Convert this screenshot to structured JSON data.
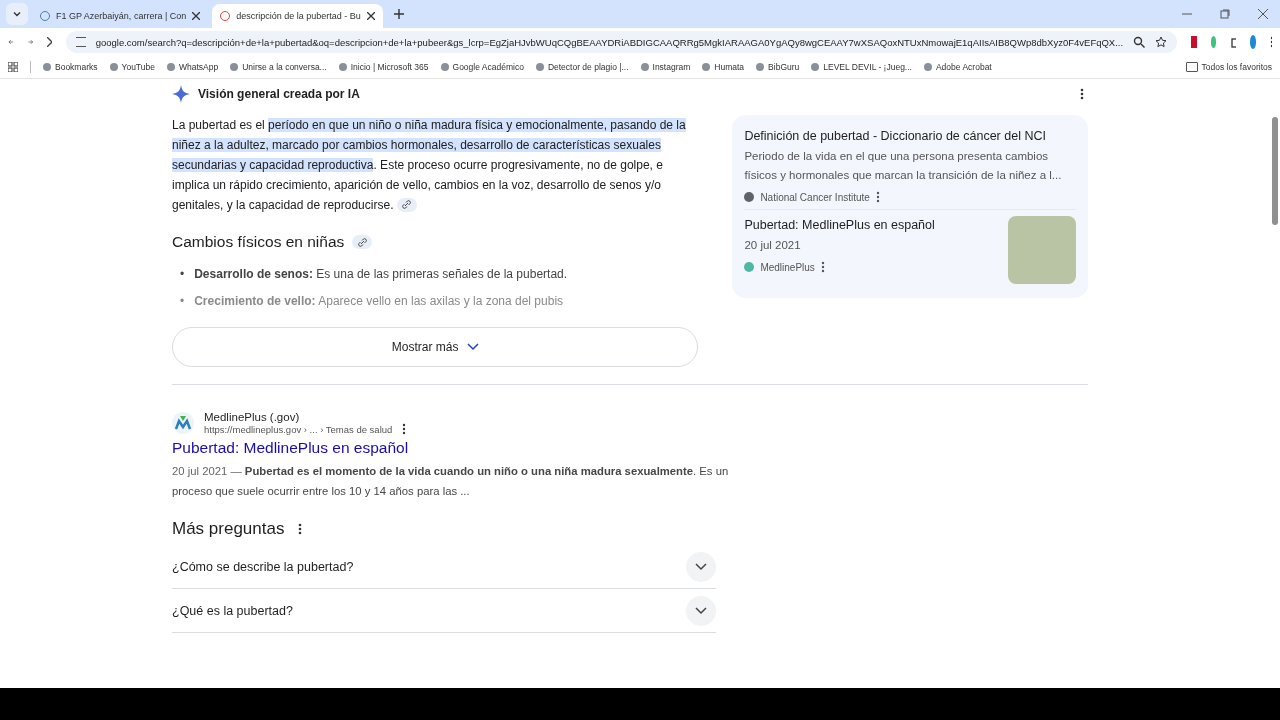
{
  "tabs": [
    {
      "title": "F1 GP Azerbaiyán, carrera | Con",
      "selected": false
    },
    {
      "title": "descripción de la pubertad - Bu",
      "selected": true
    }
  ],
  "address": "google.com/search?q=descripción+de+la+pubertad&oq=descripcion+de+la+pubeer&gs_lcrp=EgZjaHJvbWUqCQgBEAAYDRiABDIGCAAQRRg5MgkIARAAGA0YgAQy8wgCEAAY7wXSAQoxNTUxNmowajE1qAIIsAIB8QWp8dbXyz0F4vEFqQX...",
  "bookmarks": [
    "Bookmarks",
    "YouTube",
    "WhatsApp",
    "Unirse a la conversa...",
    "Inicio | Microsoft 365",
    "Google Académico",
    "Detector de plagio |...",
    "Instagram",
    "Humata",
    "BibGuru",
    "LEVEL DEVIL - ¡Jueg...",
    "Adobe Acrobat"
  ],
  "all_bookmarks": "Todos los favoritos",
  "ai_overview": {
    "title": "Visión general creada por IA",
    "paragraph": [
      {
        "text": "La pubertad es el ",
        "highlighted": false
      },
      {
        "text": "período en que un niño o niña madura física y emocionalmente, pasando de la niñez a la adultez, marcado por cambios hormonales, desarrollo de características sexuales secundarias y capacidad reproductiva",
        "highlighted": true
      },
      {
        "text": ". Este proceso ocurre progresivamente, no de golpe, e implica un rápido crecimiento, aparición de vello, cambios en la voz, desarrollo de senos y/o genitales, y la capacidad de reproducirse.",
        "highlighted": false
      }
    ],
    "subheading": "Cambios físicos en niñas",
    "bullets": [
      {
        "marker": "•",
        "text": "**Desarrollo de senos:** Es una de las primeras señales de la pubertad.",
        "faded": false
      },
      {
        "marker": "•",
        "text": "**Crecimiento de vello:** Aparece vello en las axilas y la zona del pubis",
        "faded": true
      }
    ],
    "show_more": "Mostrar más",
    "sources": [
      {
        "title": "Definición de pubertad - Diccionario de cáncer del NCI",
        "snippet": "Periodo de la vida en el que una persona presenta cambios físicos y hormonales que marcan la transición de la niñez a l...",
        "site": "National Cancer Institute",
        "kind": "text"
      },
      {
        "title": "Pubertad: MedlinePlus en español",
        "snippet": "20 jul 2021",
        "site": "MedlinePlus",
        "kind": "photo"
      }
    ]
  },
  "result": {
    "site": "MedlinePlus (.gov)",
    "url": "https://medlineplus.gov › ... › Temas de salud",
    "title": "Pubertad: MedlinePlus en español",
    "date": "20 jul 2021 — ",
    "snippet": "**Pubertad es el momento de la vida cuando un niño o una niña madura sexualmente**. Es un proceso que suele ocurrir entre los 10 y 14 años para las ..."
  },
  "questions": {
    "title": "Más preguntas",
    "items": [
      {
        "text": "¿Cómo se describe la pubertad?",
        "expanded": false
      },
      {
        "text": "¿Qué es la pubertad?",
        "expanded": false
      }
    ]
  }
}
